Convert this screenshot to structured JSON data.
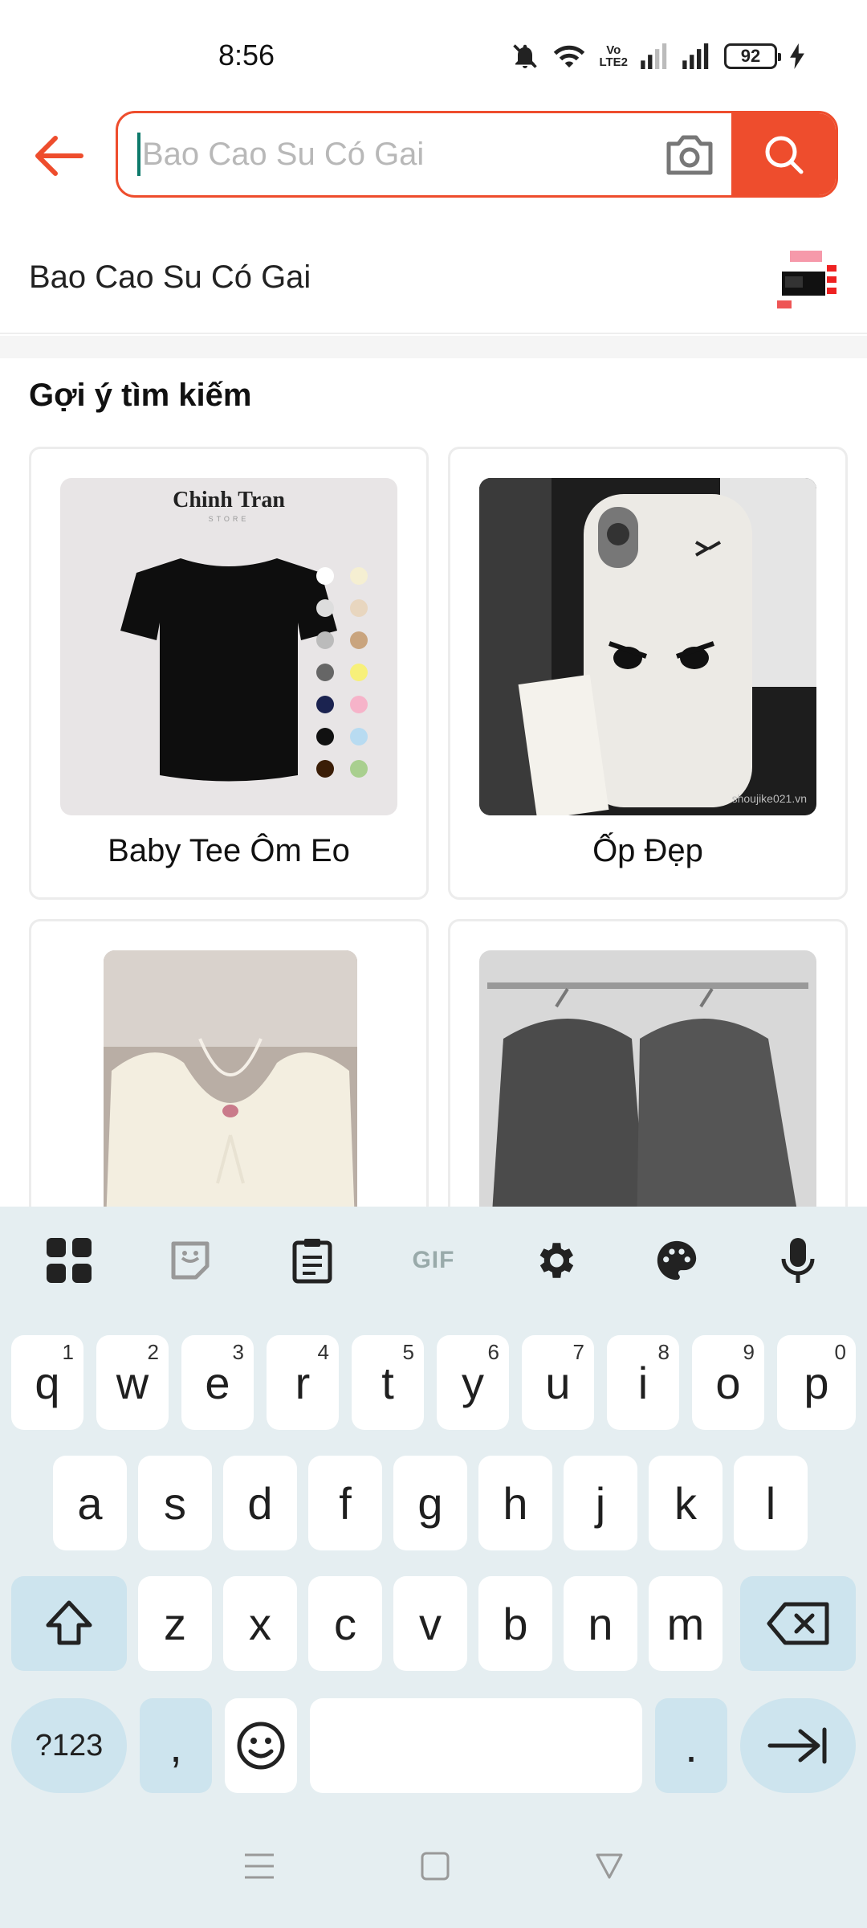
{
  "status_bar": {
    "time": "8:56",
    "volte": "Vo\nLTE2",
    "battery": "92"
  },
  "search": {
    "placeholder": "Bao Cao Su Có Gai",
    "value": ""
  },
  "suggestion": {
    "text": "Bao Cao Su Có Gai"
  },
  "section": {
    "title": "Gợi ý tìm kiếm"
  },
  "cards": [
    {
      "label": "Baby Tee Ôm Eo",
      "brand": "Chinh Tran",
      "brand_sub": "STORE"
    },
    {
      "label": "Ốp Đẹp",
      "watermark": "shoujike021.vn"
    },
    {
      "label": ""
    },
    {
      "label": ""
    }
  ],
  "keyboard": {
    "toolbar": {
      "gif": "GIF"
    },
    "row1": [
      {
        "k": "q",
        "h": "1"
      },
      {
        "k": "w",
        "h": "2"
      },
      {
        "k": "e",
        "h": "3"
      },
      {
        "k": "r",
        "h": "4"
      },
      {
        "k": "t",
        "h": "5"
      },
      {
        "k": "y",
        "h": "6"
      },
      {
        "k": "u",
        "h": "7"
      },
      {
        "k": "i",
        "h": "8"
      },
      {
        "k": "o",
        "h": "9"
      },
      {
        "k": "p",
        "h": "0"
      }
    ],
    "row2": [
      "a",
      "s",
      "d",
      "f",
      "g",
      "h",
      "j",
      "k",
      "l"
    ],
    "row3": [
      "z",
      "x",
      "c",
      "v",
      "b",
      "n",
      "m"
    ],
    "symbols_key": "?123",
    "comma_key": ",",
    "period_key": "."
  },
  "colors": {
    "accent": "#ee4d2d",
    "keyboard_bg": "#e5eef1",
    "func_key": "#cde4ee"
  }
}
